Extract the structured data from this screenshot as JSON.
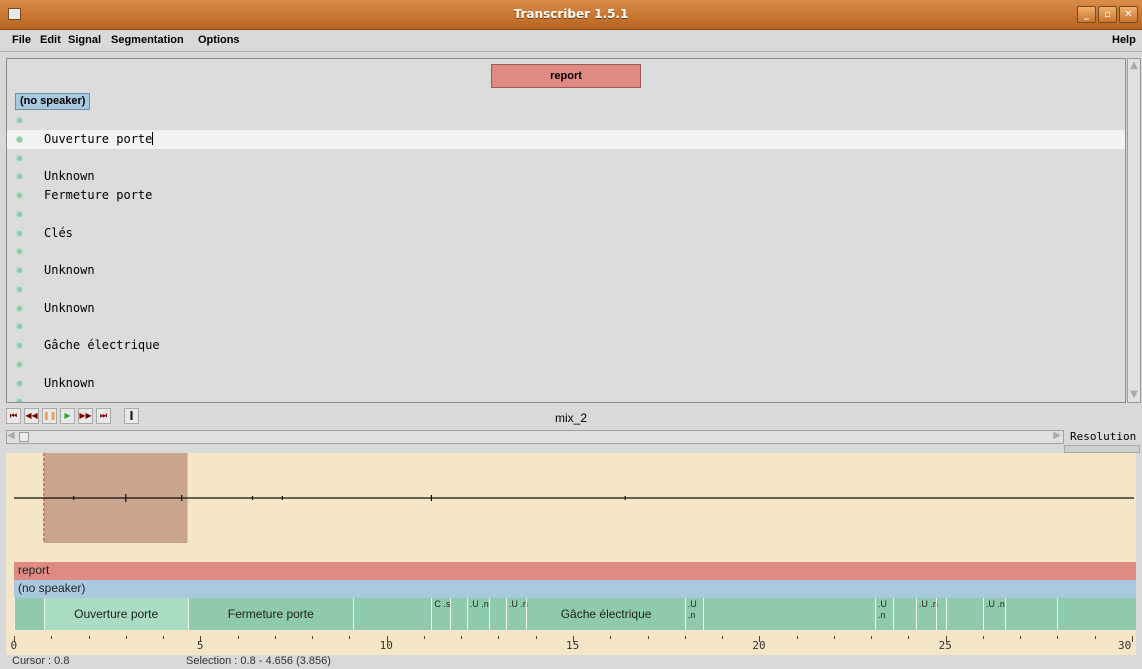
{
  "window": {
    "title": "Transcriber 1.5.1"
  },
  "menu": [
    {
      "label": "File"
    },
    {
      "label": "Edit"
    },
    {
      "label": "Signal"
    },
    {
      "label": "Segmentation"
    },
    {
      "label": "Options"
    },
    {
      "label": "Help"
    }
  ],
  "editor": {
    "section_label": "report",
    "speaker_label": "(no speaker)",
    "lines": [
      "",
      "Ouverture porte",
      "",
      "Unknown",
      "Fermeture porte",
      "",
      "Clés",
      "",
      "Unknown",
      "",
      "Unknown",
      "",
      "Gâche électrique",
      "",
      "Unknown",
      ""
    ]
  },
  "toolbar": {
    "signal_name": "mix_2"
  },
  "resolution_label": "Resolution",
  "tracks": {
    "section": "report",
    "speaker": "(no speaker)",
    "segments": [
      {
        "label": "",
        "start": 0,
        "end": 0.8
      },
      {
        "label": "Ouverture porte",
        "start": 0.8,
        "end": 4.656
      },
      {
        "label": "Fermeture porte",
        "start": 4.656,
        "end": 9.1
      },
      {
        "label": "",
        "start": 9.1,
        "end": 11.2
      },
      {
        "label": "C .s",
        "start": 11.2,
        "end": 11.7
      },
      {
        "label": "",
        "start": 11.7,
        "end": 12.15
      },
      {
        "label": ".U .n",
        "start": 12.15,
        "end": 12.75
      },
      {
        "label": "",
        "start": 12.75,
        "end": 13.2
      },
      {
        "label": ".U .n",
        "start": 13.2,
        "end": 13.75
      },
      {
        "label": "Gâche électrique",
        "start": 13.75,
        "end": 18.0
      },
      {
        "label": ".U .n",
        "start": 18.0,
        "end": 18.5
      },
      {
        "label": "",
        "start": 18.5,
        "end": 23.1
      },
      {
        "label": ".U .n",
        "start": 23.1,
        "end": 23.6
      },
      {
        "label": "",
        "start": 23.6,
        "end": 24.2
      },
      {
        "label": ".U .n",
        "start": 24.2,
        "end": 24.75
      },
      {
        "label": "",
        "start": 24.75,
        "end": 25.0
      },
      {
        "label": "",
        "start": 25.0,
        "end": 26.0
      },
      {
        "label": ".U .n",
        "start": 26.0,
        "end": 26.6
      },
      {
        "label": "",
        "start": 26.6,
        "end": 28.0
      },
      {
        "label": "",
        "start": 28.0,
        "end": 30
      }
    ]
  },
  "axis": {
    "min": 0,
    "max": 30,
    "labels": [
      "0",
      "5",
      "10",
      "15",
      "20",
      "25",
      "30"
    ]
  },
  "status": {
    "cursor": "Cursor : 0.8",
    "selection": "Selection : 0.8 - 4.656 (3.856)"
  },
  "selection": {
    "start": 0.8,
    "end": 4.656
  },
  "colors": {
    "section": "#e08a84",
    "speaker": "#a9c9df",
    "segment": "#8fcaaa",
    "wave_bg": "#f4e6c6",
    "selection": "#c8a58c"
  }
}
